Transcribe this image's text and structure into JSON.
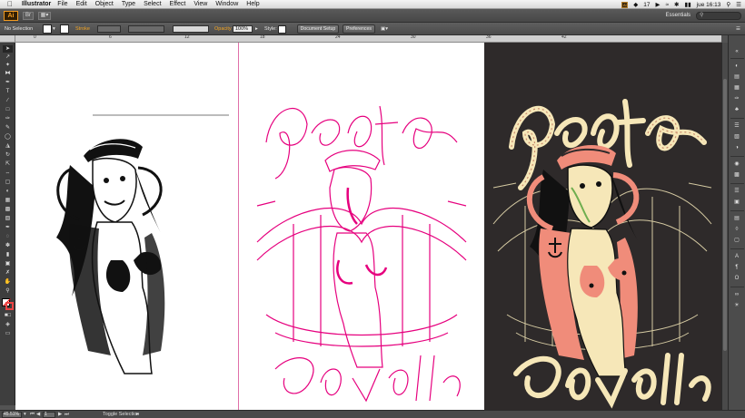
{
  "menubar": {
    "apple": "",
    "app_name": "Illustrator",
    "menus": [
      "File",
      "Edit",
      "Object",
      "Type",
      "Select",
      "Effect",
      "View",
      "Window",
      "Help"
    ],
    "status": {
      "battery_pct": "17",
      "clock": "jue 16:13"
    }
  },
  "appbar": {
    "logo": "Ai",
    "workspace": "Essentials"
  },
  "controlbar": {
    "selection": "No Selection",
    "stroke_label": "Stroke",
    "opacity_label": "Opacity",
    "opacity_value": "100%",
    "style_label": "Style:",
    "document_setup": "Document Setup",
    "preferences": "Preferences"
  },
  "ruler": {
    "labels": [
      "0",
      "6",
      "12",
      "18",
      "24",
      "30",
      "36",
      "42"
    ]
  },
  "statusbar": {
    "zoom": "45.51%",
    "artboard": "1",
    "tool_hint": "Toggle Selection"
  },
  "colors": {
    "accent_orange": "#f29a1f",
    "magenta_lines": "#e6007e",
    "dark_artboard": "#2e2a2a",
    "cream": "#f6e7b8",
    "coral": "#f08c7a"
  }
}
